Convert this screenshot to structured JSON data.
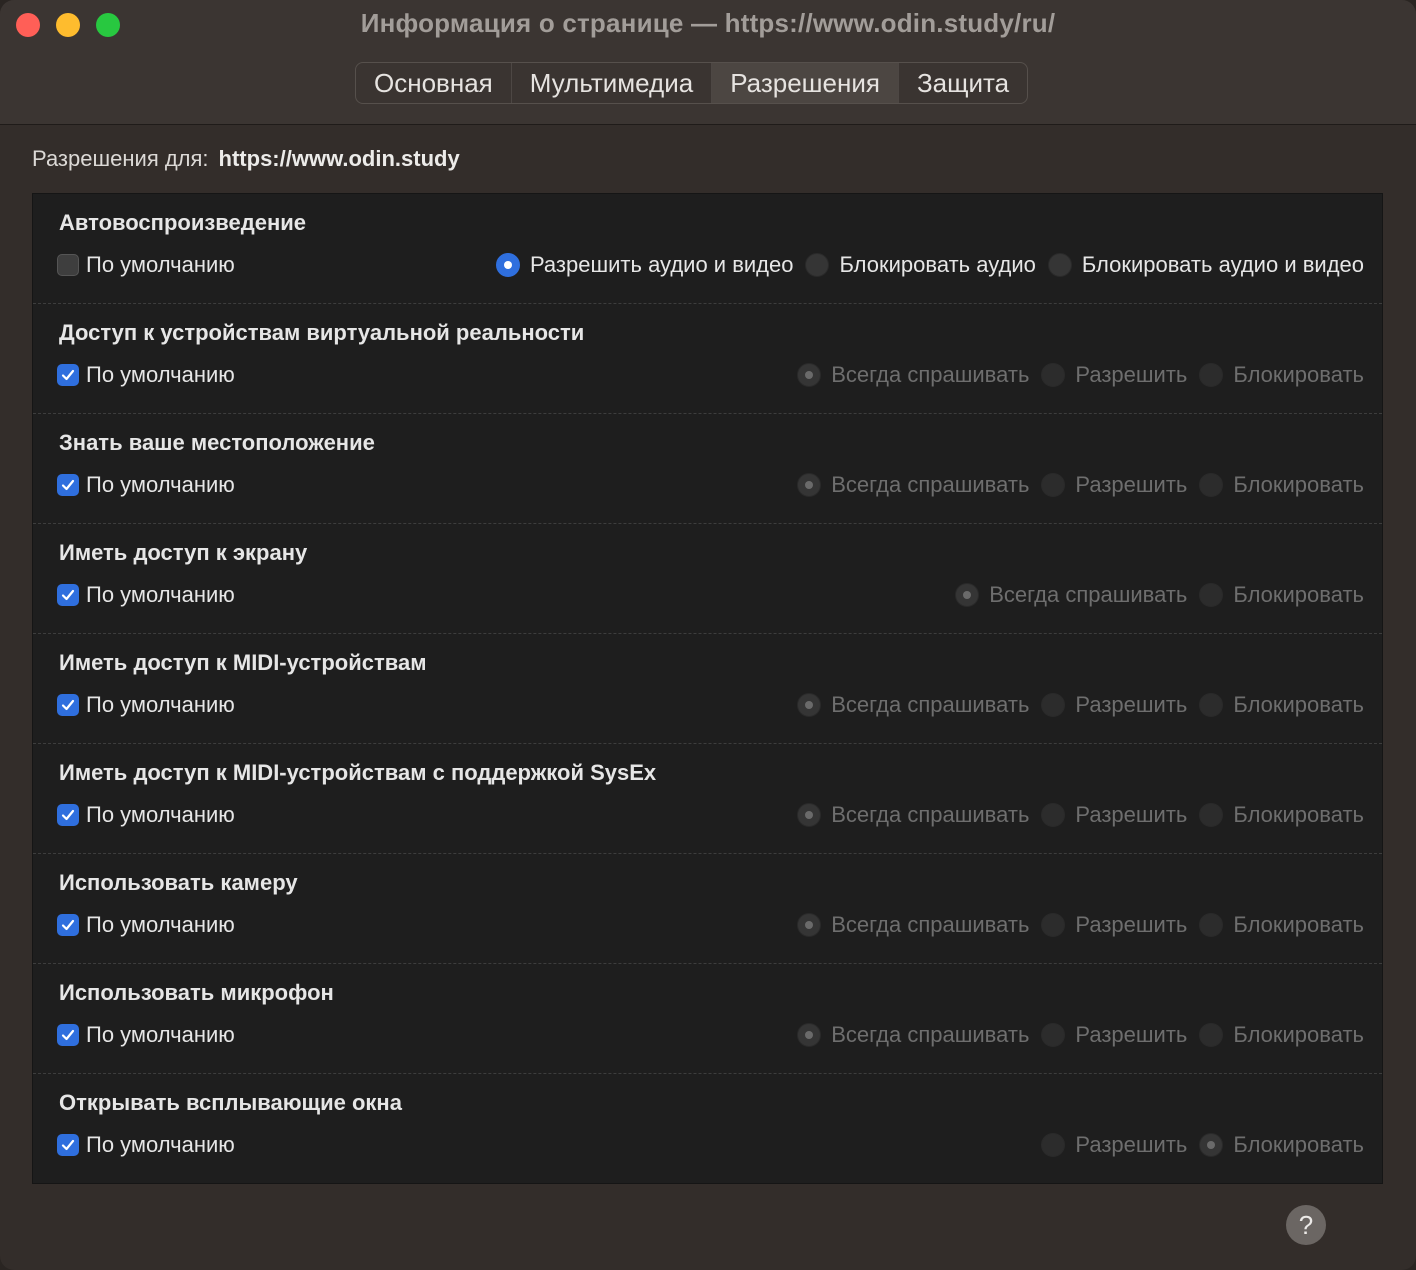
{
  "window": {
    "title": "Информация о странице — https://www.odin.study/ru/",
    "tabs": [
      {
        "label": "Основная",
        "active": false
      },
      {
        "label": "Мультимедиа",
        "active": false
      },
      {
        "label": "Разрешения",
        "active": true
      },
      {
        "label": "Защита",
        "active": false
      }
    ]
  },
  "permissions_for": {
    "label": "Разрешения для:",
    "url": "https://www.odin.study"
  },
  "default_label": "По умолчанию",
  "permissions": [
    {
      "key": "autoplay",
      "title": "Автовоспроизведение",
      "use_default": false,
      "enabled": true,
      "options": [
        {
          "label": "Разрешить аудио и видео",
          "selected": true
        },
        {
          "label": "Блокировать аудио",
          "selected": false
        },
        {
          "label": "Блокировать аудио и видео",
          "selected": false
        }
      ]
    },
    {
      "key": "xr",
      "title": "Доступ к устройствам виртуальной реальности",
      "use_default": true,
      "enabled": false,
      "options": [
        {
          "label": "Всегда спрашивать",
          "selected": true
        },
        {
          "label": "Разрешить",
          "selected": false
        },
        {
          "label": "Блокировать",
          "selected": false
        }
      ]
    },
    {
      "key": "geo",
      "title": "Знать ваше местоположение",
      "use_default": true,
      "enabled": false,
      "options": [
        {
          "label": "Всегда спрашивать",
          "selected": true
        },
        {
          "label": "Разрешить",
          "selected": false
        },
        {
          "label": "Блокировать",
          "selected": false
        }
      ]
    },
    {
      "key": "screen",
      "title": "Иметь доступ к экрану",
      "use_default": true,
      "enabled": false,
      "options": [
        {
          "label": "Всегда спрашивать",
          "selected": true
        },
        {
          "label": "Блокировать",
          "selected": false
        }
      ]
    },
    {
      "key": "midi",
      "title": "Иметь доступ к MIDI-устройствам",
      "use_default": true,
      "enabled": false,
      "options": [
        {
          "label": "Всегда спрашивать",
          "selected": true
        },
        {
          "label": "Разрешить",
          "selected": false
        },
        {
          "label": "Блокировать",
          "selected": false
        }
      ]
    },
    {
      "key": "midi-sysex",
      "title": "Иметь доступ к MIDI-устройствам с поддержкой SysEx",
      "use_default": true,
      "enabled": false,
      "options": [
        {
          "label": "Всегда спрашивать",
          "selected": true
        },
        {
          "label": "Разрешить",
          "selected": false
        },
        {
          "label": "Блокировать",
          "selected": false
        }
      ]
    },
    {
      "key": "camera",
      "title": "Использовать камеру",
      "use_default": true,
      "enabled": false,
      "options": [
        {
          "label": "Всегда спрашивать",
          "selected": true
        },
        {
          "label": "Разрешить",
          "selected": false
        },
        {
          "label": "Блокировать",
          "selected": false
        }
      ]
    },
    {
      "key": "microphone",
      "title": "Использовать микрофон",
      "use_default": true,
      "enabled": false,
      "options": [
        {
          "label": "Всегда спрашивать",
          "selected": true
        },
        {
          "label": "Разрешить",
          "selected": false
        },
        {
          "label": "Блокировать",
          "selected": false
        }
      ]
    },
    {
      "key": "popups",
      "title": "Открывать всплывающие окна",
      "use_default": true,
      "enabled": false,
      "options": [
        {
          "label": "Разрешить",
          "selected": false
        },
        {
          "label": "Блокировать",
          "selected": true
        }
      ]
    }
  ],
  "help": {
    "label": "?",
    "icon": "question-icon"
  },
  "colors": {
    "accent": "#2f6fde",
    "panel_bg": "#1e1e1e",
    "window_bg": "#332d2a"
  }
}
